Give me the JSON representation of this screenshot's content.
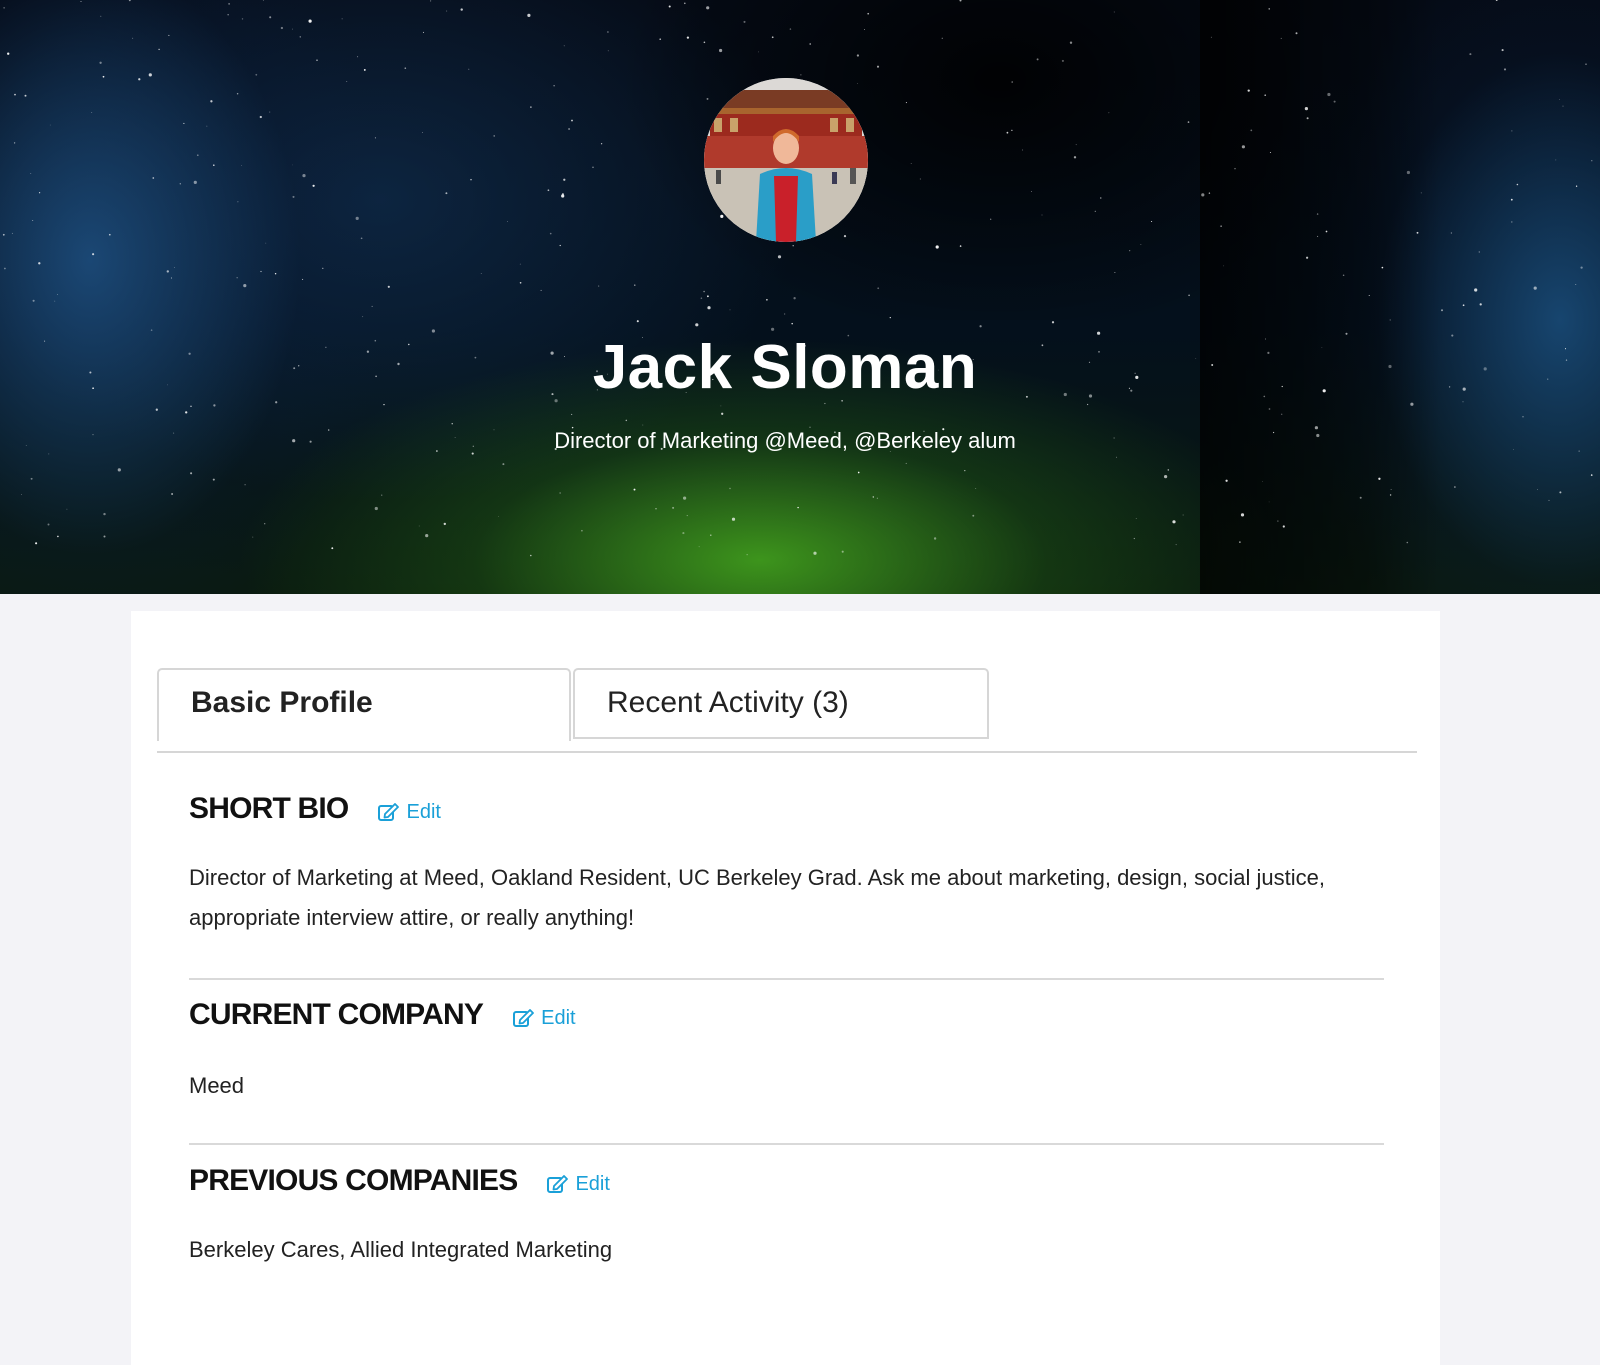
{
  "profile": {
    "name": "Jack Sloman",
    "headline": "Director of Marketing @Meed, @Berkeley alum"
  },
  "tabs": [
    {
      "label": "Basic Profile",
      "active": true
    },
    {
      "label": "Recent Activity (3)",
      "active": false
    }
  ],
  "sections": {
    "short_bio": {
      "title": "SHORT BIO",
      "edit_label": "Edit",
      "text": "Director of Marketing at Meed, Oakland Resident, UC Berkeley Grad. Ask me about marketing, design, social justice, appropriate interview attire, or really anything!"
    },
    "current_company": {
      "title": "CURRENT COMPANY",
      "edit_label": "Edit",
      "text": "Meed"
    },
    "previous_companies": {
      "title": "PREVIOUS COMPANIES",
      "edit_label": "Edit",
      "text": "Berkeley Cares, Allied Integrated Marketing"
    }
  },
  "colors": {
    "link": "#1aa0d8",
    "card_background": "#ffffff",
    "page_background": "#f3f3f7"
  },
  "icons": {
    "edit": "edit-icon"
  }
}
